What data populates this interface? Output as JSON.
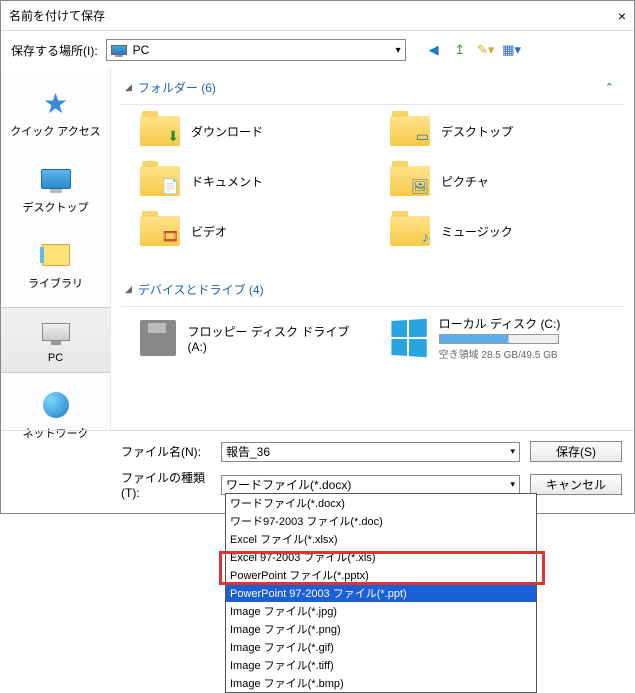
{
  "title": "名前を付けて保存",
  "location": {
    "label": "保存する場所(I):",
    "value": "PC"
  },
  "toolbar_icons": [
    "back-icon",
    "up-icon",
    "new-folder-icon",
    "views-icon"
  ],
  "sidebar": {
    "items": [
      {
        "label": "クイック アクセス",
        "icon": "star"
      },
      {
        "label": "デスクトップ",
        "icon": "monitor"
      },
      {
        "label": "ライブラリ",
        "icon": "library"
      },
      {
        "label": "PC",
        "icon": "pc",
        "selected": true
      },
      {
        "label": "ネットワーク",
        "icon": "network"
      }
    ]
  },
  "groups": {
    "folders": {
      "header": "フォルダー (6)"
    },
    "drives": {
      "header": "デバイスとドライブ (4)"
    }
  },
  "folders": [
    {
      "label": "ダウンロード",
      "badge": "↓"
    },
    {
      "label": "デスクトップ",
      "badge": ""
    },
    {
      "label": "ドキュメント",
      "badge": ""
    },
    {
      "label": "ピクチャ",
      "badge": ""
    },
    {
      "label": "ビデオ",
      "badge": ""
    },
    {
      "label": "ミュージック",
      "badge": "♪"
    }
  ],
  "drives": [
    {
      "label": "フロッピー ディスク ドライブ (A:)",
      "type": "floppy"
    },
    {
      "label": "ローカル ディスク (C:)",
      "type": "local",
      "freespace": "空き領域 28.5 GB/49.5 GB"
    }
  ],
  "form": {
    "filename_label": "ファイル名(N):",
    "filename_value": "報告_36",
    "filetype_label": "ファイルの種類(T):",
    "filetype_value": "ワードファイル(*.docx)",
    "save_btn": "保存(S)",
    "cancel_btn": "キャンセル"
  },
  "dropdown": {
    "options": [
      "ワードファイル(*.docx)",
      "ワード97-2003 ファイル(*.doc)",
      "Excel ファイル(*.xlsx)",
      "Excel 97-2003 ファイル(*.xls)",
      "PowerPoint ファイル(*.pptx)",
      "PowerPoint 97-2003 ファイル(*.ppt)",
      "Image ファイル(*.jpg)",
      "Image ファイル(*.png)",
      "Image ファイル(*.gif)",
      "Image ファイル(*.tiff)",
      "Image ファイル(*.bmp)"
    ],
    "selected_index": 5
  }
}
